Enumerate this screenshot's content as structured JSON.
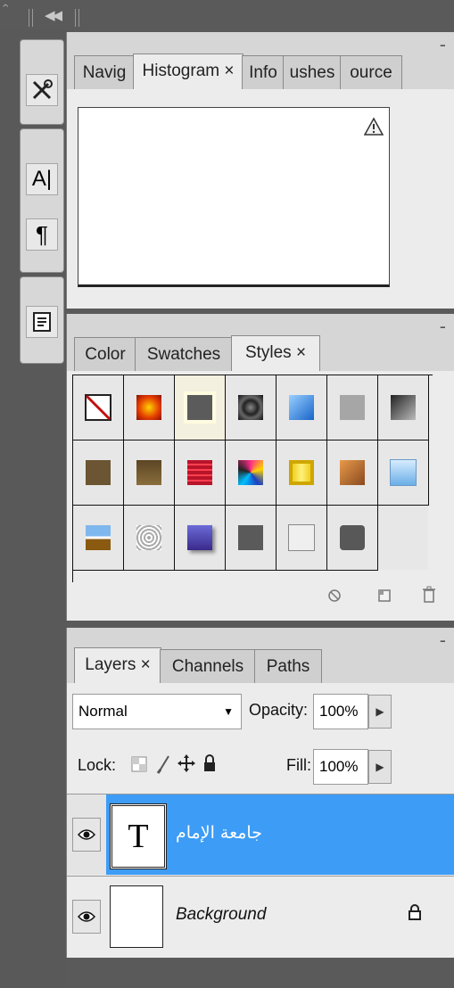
{
  "colors": {
    "accent": "#3d9cf5",
    "panel_bg": "#ececec"
  },
  "dock": {
    "collapse_icon": "double-chevron-left-icon",
    "tools": [
      {
        "name": "tools-icon"
      },
      {
        "glyph": "A|"
      },
      {
        "glyph": "¶"
      },
      {
        "name": "notes-icon"
      }
    ]
  },
  "histogram_panel": {
    "tabs": [
      "Navig",
      "Histogram ×",
      "Info",
      "ushes",
      "ource"
    ],
    "warning_icon": "warning-icon"
  },
  "styles_panel": {
    "tabs": [
      "Color",
      "Swatches",
      "Styles ×"
    ],
    "footer_icons": [
      "clear-style-icon",
      "new-style-icon",
      "trash-icon"
    ]
  },
  "layers_panel": {
    "tabs": [
      "Layers ×",
      "Channels",
      "Paths"
    ],
    "blend_mode": "Normal",
    "opacity_label": "Opacity:",
    "opacity_value": "100%",
    "lock_label": "Lock:",
    "fill_label": "Fill:",
    "fill_value": "100%",
    "layers": [
      {
        "name": "جامعة الإمام",
        "thumb_glyph": "T",
        "selected": true
      },
      {
        "name": "Background",
        "thumb_glyph": "",
        "selected": false,
        "locked": true
      }
    ]
  }
}
